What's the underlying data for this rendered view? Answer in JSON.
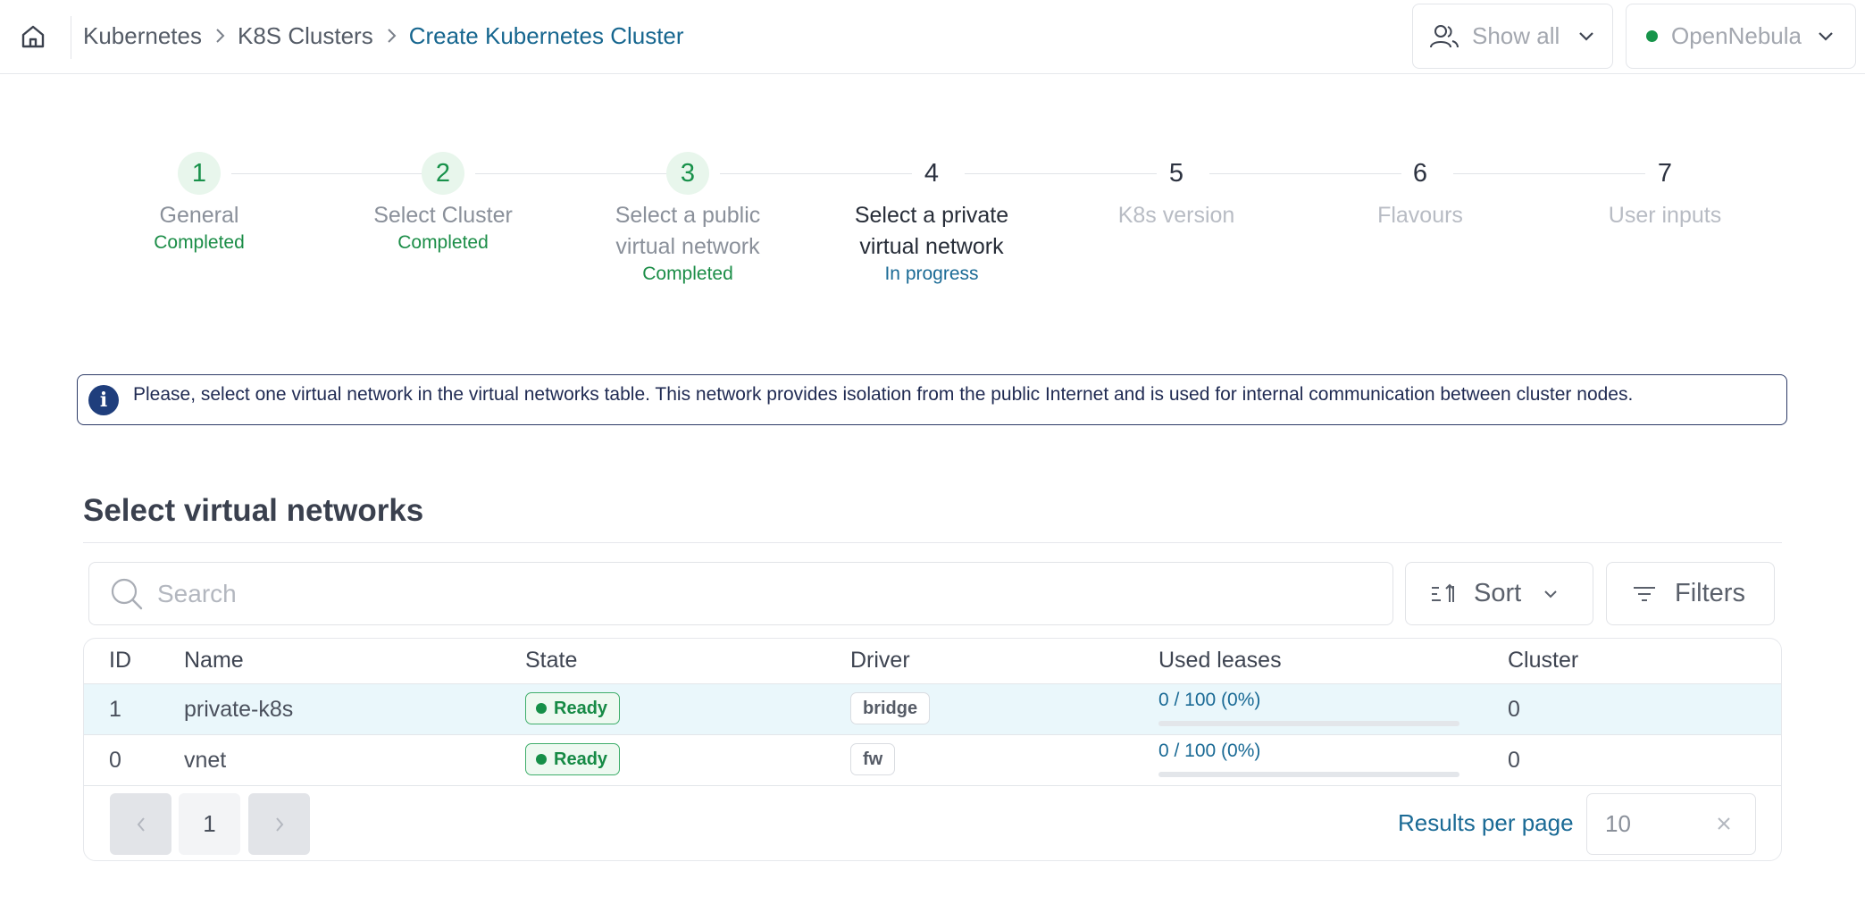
{
  "breadcrumb": {
    "items": [
      "Kubernetes",
      "K8S Clusters"
    ],
    "current": "Create Kubernetes Cluster"
  },
  "header": {
    "group_filter_label": "Show all",
    "cloud_label": "OpenNebula",
    "cloud_status_color": "#17944a"
  },
  "stepper": {
    "steps": [
      {
        "number": "1",
        "title_line1": "General",
        "title_line2": "",
        "status": "Completed",
        "state": "completed"
      },
      {
        "number": "2",
        "title_line1": "Select Cluster",
        "title_line2": "",
        "status": "Completed",
        "state": "completed"
      },
      {
        "number": "3",
        "title_line1": "Select a public",
        "title_line2": "virtual network",
        "status": "Completed",
        "state": "completed"
      },
      {
        "number": "4",
        "title_line1": "Select a private",
        "title_line2": "virtual network",
        "status": "In progress",
        "state": "in-progress"
      },
      {
        "number": "5",
        "title_line1": "K8s version",
        "title_line2": "",
        "status": "",
        "state": "pending"
      },
      {
        "number": "6",
        "title_line1": "Flavours",
        "title_line2": "",
        "status": "",
        "state": "pending"
      },
      {
        "number": "7",
        "title_line1": "User inputs",
        "title_line2": "",
        "status": "",
        "state": "pending"
      }
    ]
  },
  "info": {
    "icon": "info-icon",
    "text": "Please, select one virtual network in the virtual networks table. This network provides isolation from the public Internet and is used for internal communication between cluster nodes."
  },
  "section": {
    "title": "Select virtual networks"
  },
  "toolbar": {
    "search_placeholder": "Search",
    "sort_label": "Sort",
    "filters_label": "Filters"
  },
  "table": {
    "columns": [
      "ID",
      "Name",
      "State",
      "Driver",
      "Used leases",
      "Cluster"
    ],
    "rows": [
      {
        "id": "1",
        "name": "private-k8s",
        "state": "Ready",
        "driver": "bridge",
        "leases": "0 / 100 (0%)",
        "leases_fraction": 0,
        "cluster": "0",
        "selected": true
      },
      {
        "id": "0",
        "name": "vnet",
        "state": "Ready",
        "driver": "fw",
        "leases": "0 / 100 (0%)",
        "leases_fraction": 0,
        "cluster": "0",
        "selected": false
      }
    ]
  },
  "pagination": {
    "current_page": "1",
    "results_per_page_label": "Results per page",
    "results_per_page_value": "10"
  },
  "colors": {
    "accent": "#16668f",
    "success": "#18914a",
    "info_border": "#2c3a66"
  }
}
